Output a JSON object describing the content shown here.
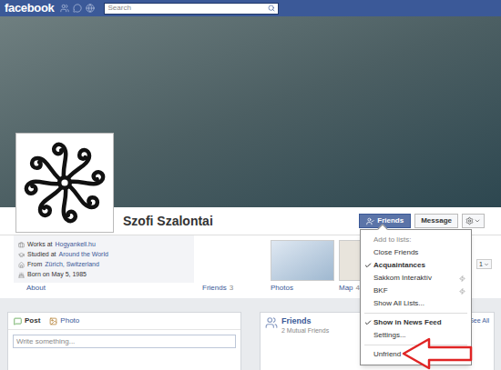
{
  "topbar": {
    "logo": "facebook",
    "search": {
      "placeholder": "Search"
    }
  },
  "profile": {
    "name": "Szofi Szalontai",
    "info": [
      {
        "kind": "work",
        "parts": [
          {
            "text": "Works at",
            "link": false
          },
          {
            "text": "Hogyankell.hu",
            "link": true
          }
        ]
      },
      {
        "kind": "study",
        "parts": [
          {
            "text": "Studied at",
            "link": false
          },
          {
            "text": "Around the World",
            "link": true
          }
        ]
      },
      {
        "kind": "from",
        "parts": [
          {
            "text": "From",
            "link": false
          },
          {
            "text": "Zürich, Switzerland",
            "link": true
          }
        ]
      },
      {
        "kind": "born",
        "parts": [
          {
            "text": "Born on May 5, 1985",
            "link": false
          }
        ]
      }
    ]
  },
  "friends_button": {
    "label": "Friends",
    "open": true
  },
  "message_button": {
    "label": "Message"
  },
  "nav": [
    {
      "label": "About",
      "count": "",
      "kind": "about"
    },
    {
      "label": "Friends",
      "count": "3",
      "kind": "friends"
    },
    {
      "label": "Photos",
      "count": "",
      "kind": "photos"
    },
    {
      "label": "Map",
      "count": "4",
      "kind": "map"
    }
  ],
  "map_control": {
    "label": "1"
  },
  "friends_menu": {
    "sections": [
      [
        {
          "label": "Add to lists:",
          "kind": "header",
          "checked": false,
          "bolt": false
        },
        {
          "label": "Close Friends",
          "kind": "option",
          "checked": false,
          "bolt": false
        },
        {
          "label": "Acquaintances",
          "kind": "option",
          "checked": true,
          "bolt": false
        },
        {
          "label": "Sakkom Interaktív",
          "kind": "option",
          "checked": false,
          "bolt": true
        },
        {
          "label": "BKF",
          "kind": "option",
          "checked": false,
          "bolt": true
        },
        {
          "label": "Show All Lists...",
          "kind": "option",
          "checked": false,
          "bolt": false
        }
      ],
      [
        {
          "label": "Show in News Feed",
          "kind": "option",
          "checked": true,
          "bolt": false
        },
        {
          "label": "Settings...",
          "kind": "option",
          "checked": false,
          "bolt": false
        }
      ],
      [
        {
          "label": "Unfriend",
          "kind": "option",
          "checked": false,
          "bolt": false
        }
      ]
    ]
  },
  "composer": {
    "tabs": [
      {
        "label": "Post",
        "selected": true,
        "kind": "post"
      },
      {
        "label": "Photo",
        "selected": false,
        "kind": "photo"
      }
    ],
    "placeholder": "Write something..."
  },
  "friends_panel": {
    "title": "Friends",
    "subtitle": "2 Mutual Friends",
    "link": "See All"
  }
}
